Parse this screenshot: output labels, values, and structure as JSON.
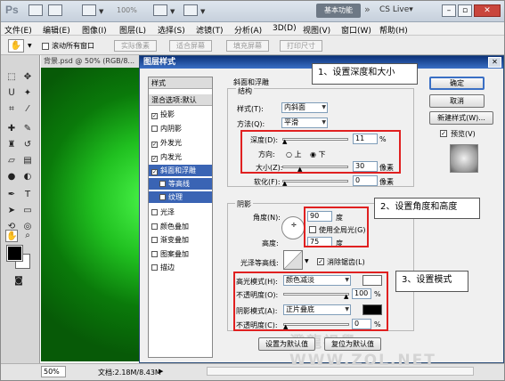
{
  "app": {
    "logo": "Ps",
    "zoom_display": "100%",
    "workspace": "基本功能",
    "cslive": "CS Live▾"
  },
  "menu": [
    "文件(E)",
    "编辑(E)",
    "图像(I)",
    "图层(L)",
    "选择(S)",
    "滤镜(T)",
    "分析(A)",
    "3D(D)",
    "视图(V)",
    "窗口(W)",
    "帮助(H)"
  ],
  "options": {
    "scroll_all": "滚动所有窗口",
    "actual": "实际像素",
    "fit": "适合屏幕",
    "fill": "填充屏幕",
    "print": "打印尺寸"
  },
  "document": {
    "tab": "背景.psd @ 50% (RGB/8...",
    "zoom": "50%",
    "info": "文档:2.18M/8.43M"
  },
  "dialog": {
    "title": "图层样式",
    "styles_header": "样式",
    "blend_options": "混合选项:默认",
    "effects": [
      {
        "label": "投影",
        "checked": true
      },
      {
        "label": "内阴影",
        "checked": false
      },
      {
        "label": "外发光",
        "checked": true
      },
      {
        "label": "内发光",
        "checked": true
      },
      {
        "label": "斜面和浮雕",
        "checked": true
      },
      {
        "label": "等高线",
        "checked": false
      },
      {
        "label": "纹理",
        "checked": false
      },
      {
        "label": "光泽",
        "checked": false
      },
      {
        "label": "颜色叠加",
        "checked": false
      },
      {
        "label": "渐变叠加",
        "checked": false
      },
      {
        "label": "图案叠加",
        "checked": false
      },
      {
        "label": "描边",
        "checked": false
      }
    ],
    "section": "斜面和浮雕",
    "structure": "结构",
    "style_label": "样式(T):",
    "style_value": "内斜面",
    "technique_label": "方法(Q):",
    "technique_value": "平滑",
    "depth_label": "深度(D):",
    "depth_value": "11",
    "depth_unit": "%",
    "direction_label": "方向:",
    "dir_up": "上",
    "dir_down": "下",
    "size_label": "大小(Z):",
    "size_value": "30",
    "size_unit": "像素",
    "soften_label": "软化(F):",
    "soften_value": "0",
    "soften_unit": "像素",
    "shading": "阴影",
    "angle_label": "角度(N):",
    "angle_value": "90",
    "angle_unit": "度",
    "global_light": "使用全局光(G)",
    "altitude_label": "高度:",
    "altitude_value": "75",
    "altitude_unit": "度",
    "gloss_label": "光泽等高线:",
    "antialias": "消除锯齿(L)",
    "highlight_label": "高光模式(H):",
    "highlight_value": "颜色减淡",
    "op1_label": "不透明度(O):",
    "op1_value": "100",
    "op1_unit": "%",
    "shadow_label": "阴影模式(A):",
    "shadow_value": "正片叠底",
    "op2_label": "不透明度(C):",
    "op2_value": "0",
    "op2_unit": "%",
    "make_default": "设置为默认值",
    "reset_default": "复位为默认值",
    "ok": "确定",
    "cancel": "取消",
    "new_style": "新建样式(W)...",
    "preview": "预览(V)"
  },
  "callouts": {
    "c1": "1、设置深度和大小",
    "c2": "2、设置角度和高度",
    "c3": "3、设置模式"
  },
  "watermark": "澄龍視覺 WWW.ZOL.NET",
  "colors": {
    "highlight_swatch": "#ffffff",
    "shadow_swatch": "#000000",
    "canvas_green": "#20c020"
  }
}
